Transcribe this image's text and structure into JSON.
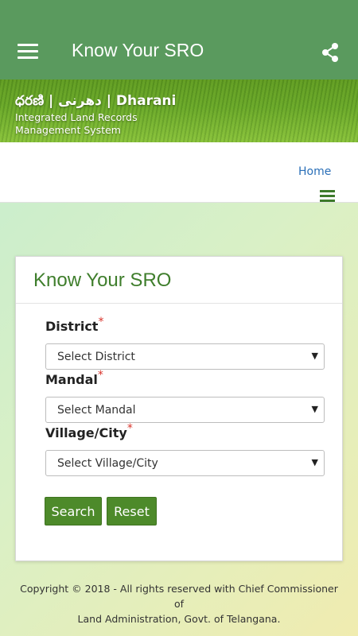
{
  "appbar": {
    "title": "Know Your SRO",
    "menu_icon": "hamburger-menu-icon",
    "share_icon": "share-icon"
  },
  "banner": {
    "title": "ధరణి | دھرنی | Dharani",
    "subtitle_line1": "Integrated Land Records",
    "subtitle_line2": "Management System"
  },
  "nav": {
    "home_label": "Home",
    "toggle_icon": "hamburger-menu-icon"
  },
  "form": {
    "title": "Know Your SRO",
    "required_marker": "*",
    "district": {
      "label": "District",
      "selected": "Select District"
    },
    "mandal": {
      "label": "Mandal",
      "selected": "Select Mandal"
    },
    "village": {
      "label": "Village/City",
      "selected": "Select Village/City"
    },
    "search_label": "Search",
    "reset_label": "Reset"
  },
  "footer": {
    "line1": "Copyright © 2018 - All rights reserved with Chief Commissioner of",
    "line2": "Land Administration, Govt. of Telangana."
  },
  "colors": {
    "appbar": "#5a9a5e",
    "accent_green": "#4d8a2a",
    "title_green": "#3f7e2c",
    "link_blue": "#2a6fb8",
    "required_red": "#d9342b"
  }
}
